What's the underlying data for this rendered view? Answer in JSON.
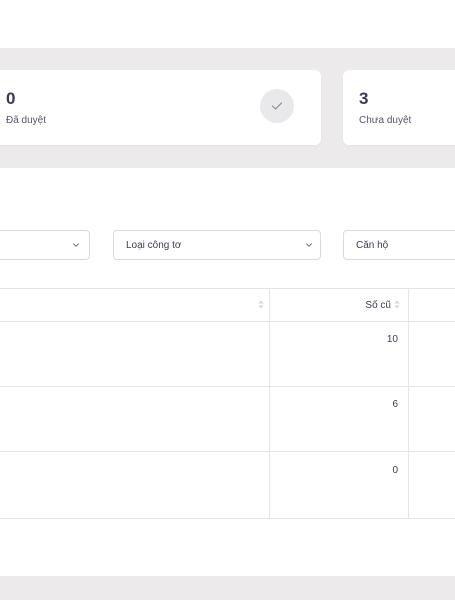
{
  "stats": {
    "approved": {
      "value": "0",
      "label": "Đã duyệt"
    },
    "pending": {
      "value": "3",
      "label": "Chưa duyệt"
    }
  },
  "filters": {
    "first": {
      "value": ""
    },
    "meter_type": {
      "value": "Loại công tơ"
    },
    "apartment": {
      "value": "Căn hộ"
    }
  },
  "table": {
    "columns": [
      "",
      "Số cũ",
      ""
    ],
    "rows": [
      {
        "old_reading": "10"
      },
      {
        "old_reading": "6"
      },
      {
        "old_reading": "0"
      }
    ]
  }
}
